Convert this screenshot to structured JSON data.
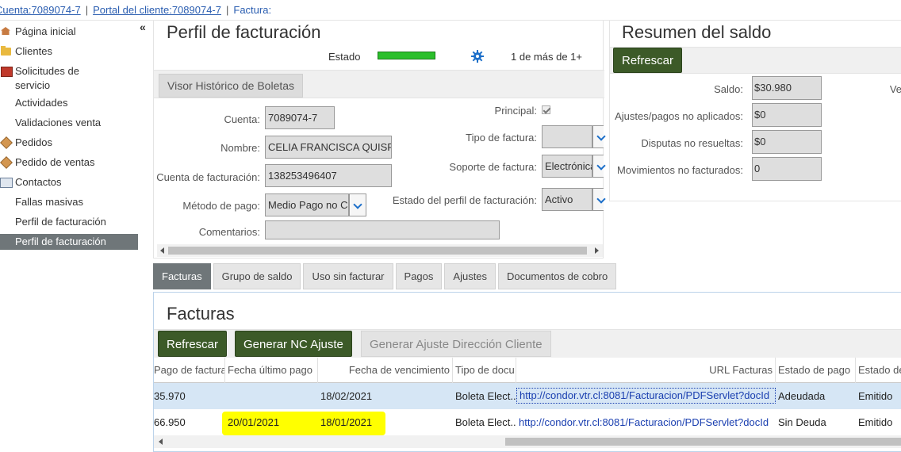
{
  "breadcrumb": {
    "cuenta": "Cuenta:7089074-7",
    "portal": "Portal del cliente:7089074-7",
    "factura": "Factura:",
    "separator": "|"
  },
  "sidebar": {
    "collapse_glyph": "«",
    "items": [
      {
        "label": "Página inicial",
        "icon": "home-icon"
      },
      {
        "label": "Clientes",
        "icon": "folder-icon"
      },
      {
        "label": "Solicitudes de servicio",
        "icon": "box-icon"
      },
      {
        "label": "Actividades",
        "icon": ""
      },
      {
        "label": "Validaciones venta",
        "icon": ""
      },
      {
        "label": "Pedidos",
        "icon": "cube-icon"
      },
      {
        "label": "Pedido de ventas",
        "icon": "cube-icon"
      },
      {
        "label": "Contactos",
        "icon": "card-icon"
      },
      {
        "label": "Fallas masivas",
        "icon": ""
      },
      {
        "label": "Perfil de facturación",
        "icon": ""
      },
      {
        "label": "Perfil de facturación",
        "icon": "",
        "active": true
      }
    ]
  },
  "perfil": {
    "title": "Perfil de facturación",
    "estado_label": "Estado",
    "estado_color": "#2bbf2b",
    "pager": "1 de más de 1+",
    "visor_button": "Visor Histórico de Boletas",
    "fields": {
      "cuenta_label": "Cuenta:",
      "cuenta_value": "7089074-7",
      "nombre_label": "Nombre:",
      "nombre_value": "CELIA FRANCISCA QUISPE",
      "cuenta_fact_label": "Cuenta de facturación:",
      "cuenta_fact_value": "138253496407",
      "metodo_label": "Método de pago:",
      "metodo_value": "Medio Pago no C",
      "comentarios_label": "Comentarios:",
      "comentarios_value": "",
      "principal_label": "Principal:",
      "principal_checked": true,
      "tipo_label": "Tipo de factura:",
      "tipo_value": "",
      "soporte_label": "Soporte de factura:",
      "soporte_value": "Electrónica",
      "estado_perfil_label": "Estado del perfil de facturación:",
      "estado_perfil_value": "Activo"
    }
  },
  "resumen": {
    "title": "Resumen del saldo",
    "refresh_button": "Refrescar",
    "saldo_label": "Saldo:",
    "saldo_value": "$30.980",
    "ajustes_label": "Ajustes/pagos no aplicados:",
    "ajustes_value": "$0",
    "disputas_label": "Disputas no resueltas:",
    "disputas_value": "$0",
    "movimientos_label": "Movimientos no facturados:",
    "movimientos_value": "0",
    "cut_label": "Ve"
  },
  "tabs": [
    "Facturas",
    "Grupo de saldo",
    "Uso sin facturar",
    "Pagos",
    "Ajustes",
    "Documentos de cobro"
  ],
  "facturas": {
    "title": "Facturas",
    "buttons": {
      "refrescar": "Refrescar",
      "generar_nc": "Generar NC Ajuste",
      "generar_dir": "Generar Ajuste Dirección Cliente"
    },
    "columns": [
      "Pago de factura",
      "Fecha último pago",
      "Fecha de vencimiento",
      "Tipo de docu",
      "URL Facturas",
      "Estado de pago",
      "Estado de"
    ],
    "rows": [
      {
        "pago": "35.970",
        "fecha_ultimo": "",
        "vencimiento": "18/02/2021",
        "tipo": "Boleta Elect...",
        "url": "http://condor.vtr.cl:8081/Facturacion/PDFServlet?docId",
        "estado_pago": "Adeudada",
        "estado": "Emitido",
        "selected": true
      },
      {
        "pago": "66.950",
        "fecha_ultimo": "20/01/2021",
        "vencimiento": "18/01/2021",
        "tipo": "Boleta Elect...",
        "url": "http://condor.vtr.cl:8081/Facturacion/PDFServlet?docId",
        "estado_pago": "Sin Deuda",
        "estado": "Emitido",
        "selected": false
      }
    ],
    "highlight_color": "#ffff00"
  },
  "colors": {
    "dark_button": "#3c5a28",
    "active_tab": "#6f7679",
    "link": "#2a5db0"
  }
}
